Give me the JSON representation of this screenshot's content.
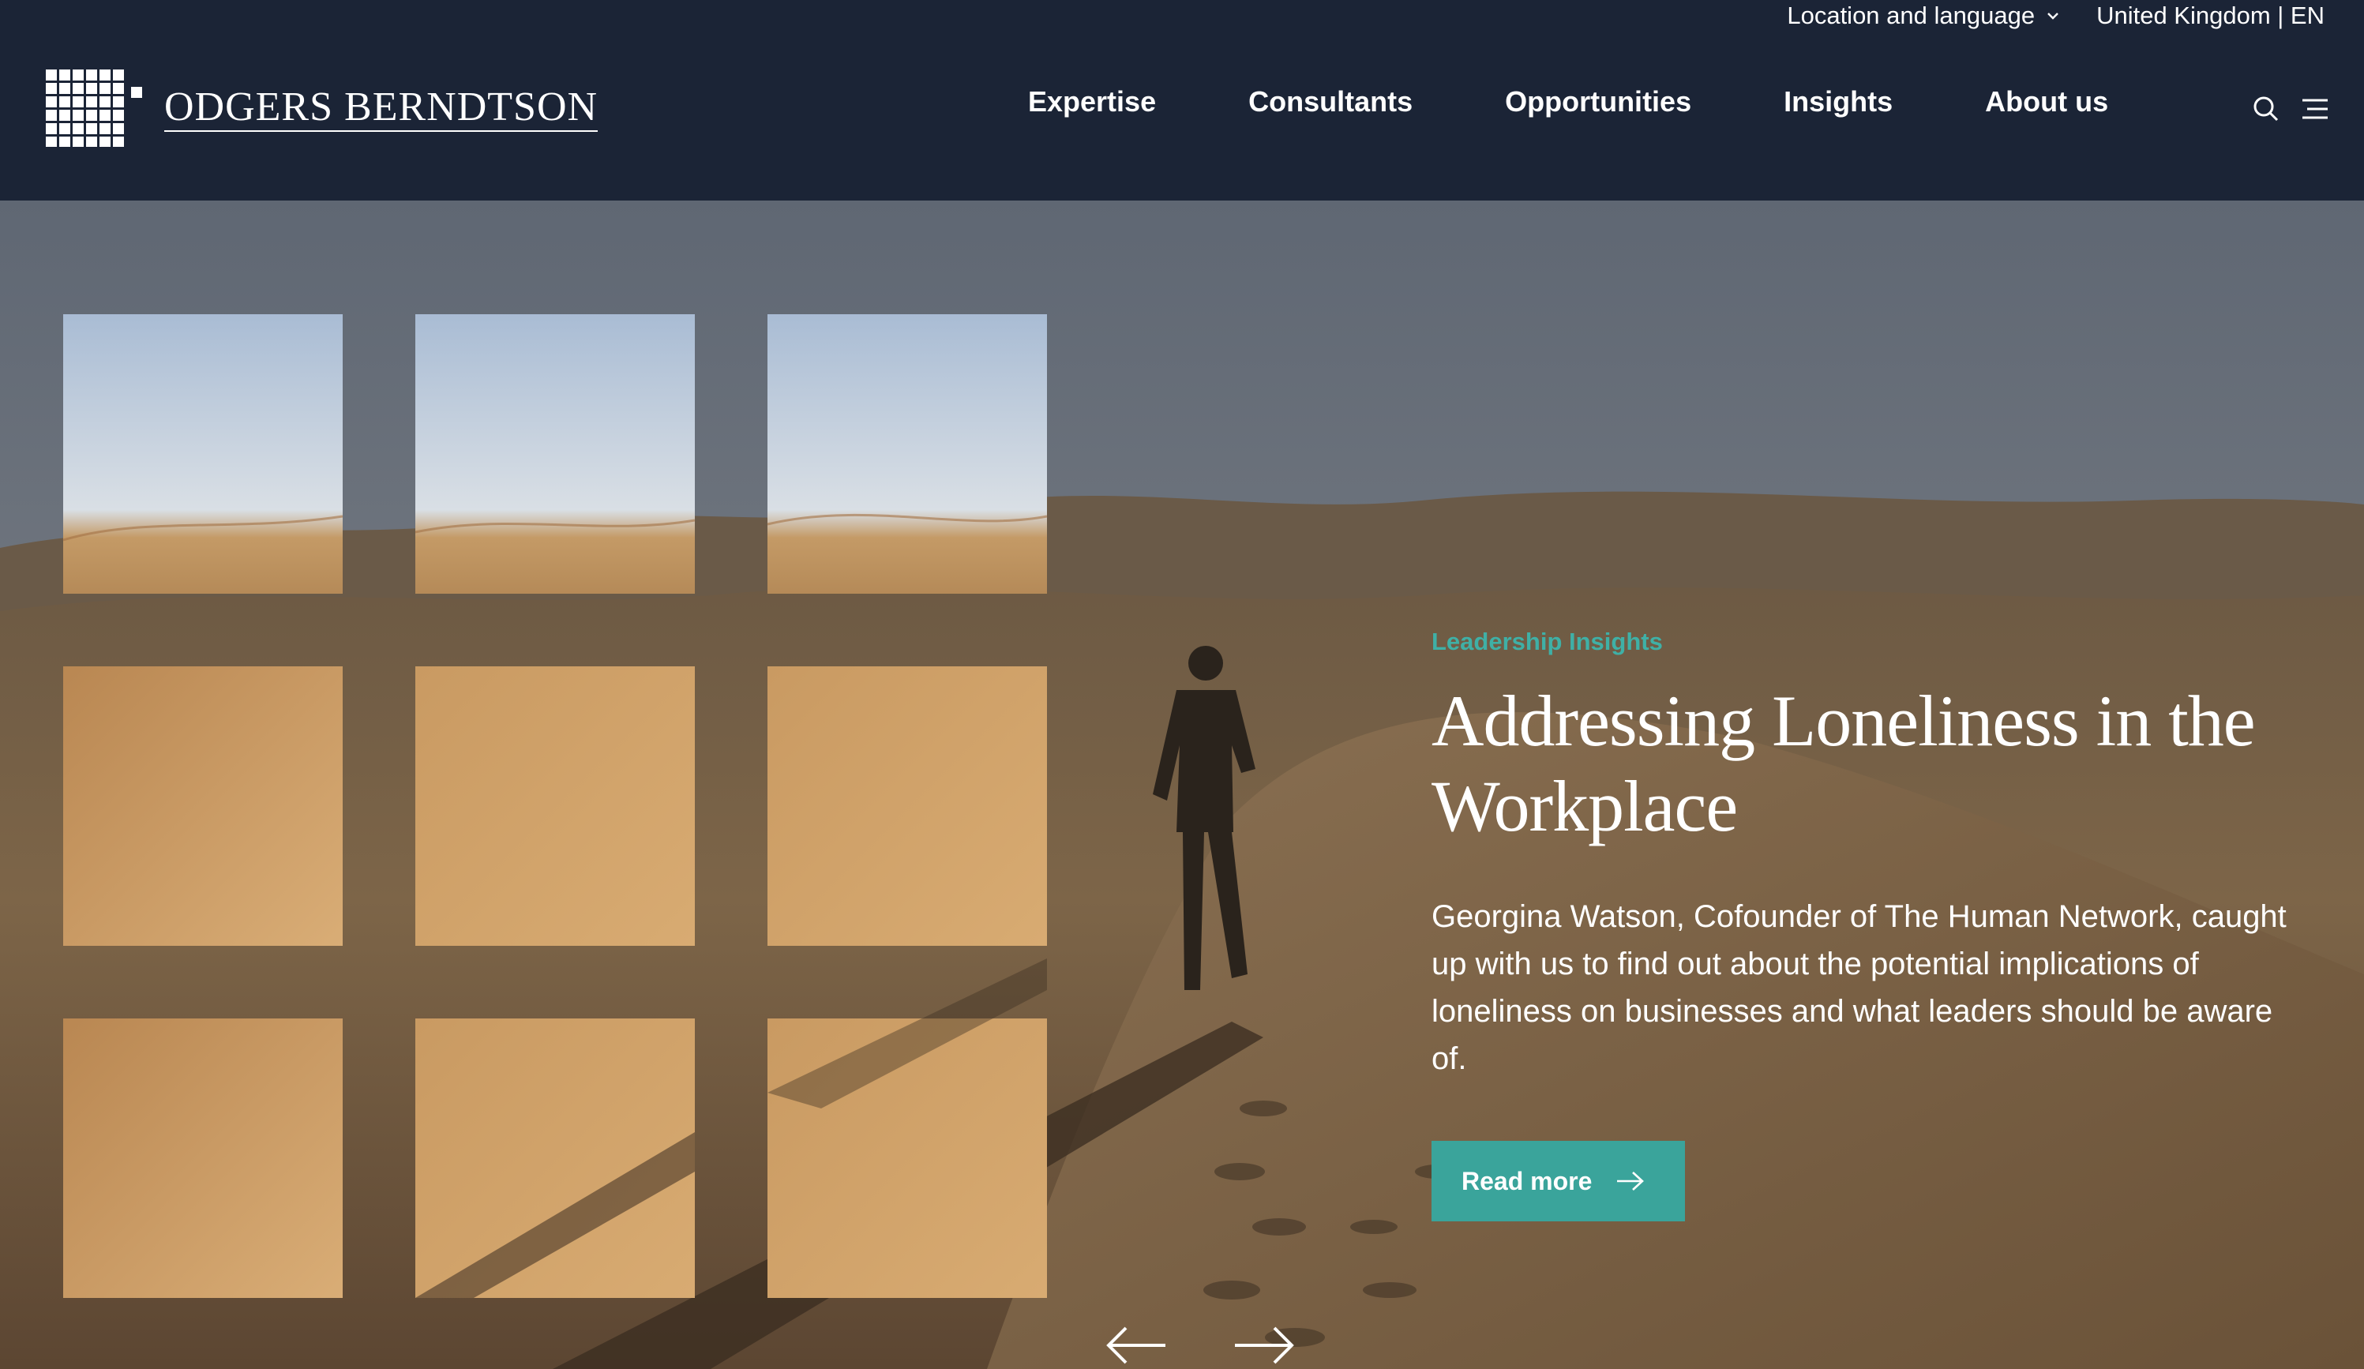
{
  "header": {
    "location_label": "Location and language",
    "region_label": "United Kingdom | EN",
    "brand_name": "ODGERS BERNDTSON",
    "nav": [
      "Expertise",
      "Consultants",
      "Opportunities",
      "Insights",
      "About us"
    ],
    "icons": [
      "search-icon",
      "menu-icon",
      "chevron-down-icon"
    ]
  },
  "hero": {
    "category": "Leadership Insights",
    "title": "Addressing Loneliness in the Workplace",
    "summary": "Georgina Watson, Cofounder of The Human Network, caught up with us to find out about the potential implications of loneliness on businesses and what leaders should be aware of.",
    "cta_label": "Read more",
    "carousel_icons": [
      "arrow-left-icon",
      "arrow-right-icon"
    ]
  },
  "colors": {
    "header_bg": "#1b2436",
    "accent": "#3aa49b",
    "kicker": "#3fb0a6",
    "text": "#ffffff"
  }
}
